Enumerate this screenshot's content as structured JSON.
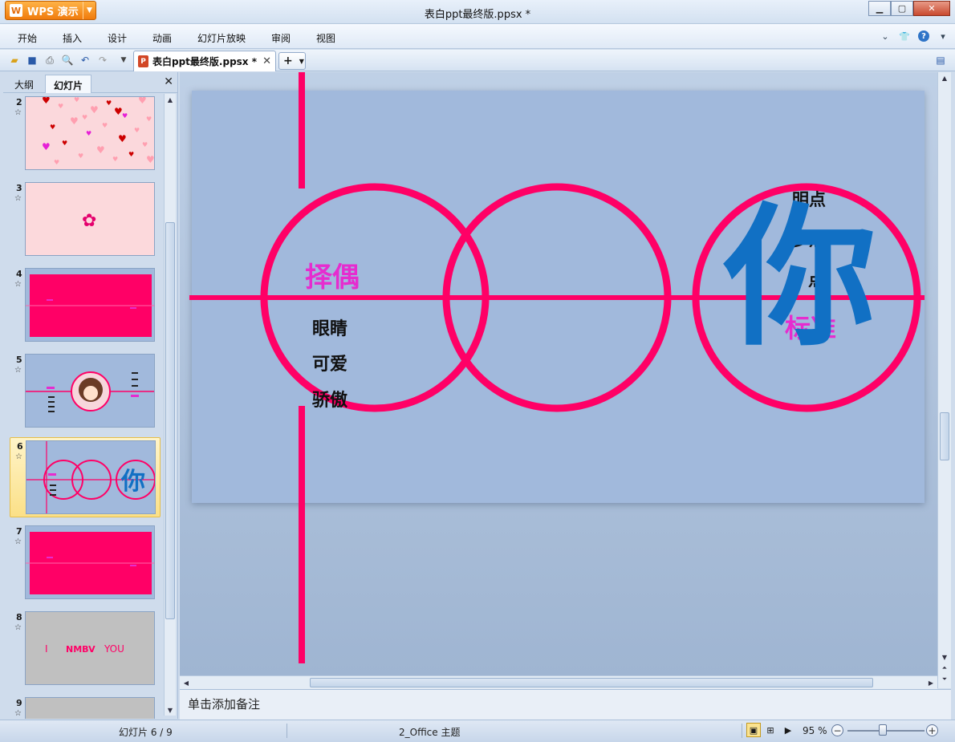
{
  "app": {
    "name": "WPS 演示",
    "doc_title": "表白ppt最终版.ppsx *"
  },
  "menu": [
    "开始",
    "插入",
    "设计",
    "动画",
    "幻灯片放映",
    "审阅",
    "视图"
  ],
  "tab": {
    "label": "表白ppt最终版.ppsx *"
  },
  "left_panel": {
    "tabs": [
      "大纲",
      "幻灯片"
    ],
    "active_tab": "幻灯片",
    "slides": [
      {
        "num": "2",
        "kind": "hearts",
        "bg": "#fbd8dc"
      },
      {
        "num": "3",
        "kind": "flower",
        "bg": "#fcd9dc"
      },
      {
        "num": "4",
        "kind": "pink-lines",
        "bg": "#ff0066"
      },
      {
        "num": "5",
        "kind": "avatar",
        "bg": "#a1b9dc"
      },
      {
        "num": "6",
        "kind": "circles",
        "bg": "#a1b9dc",
        "selected": true
      },
      {
        "num": "7",
        "kind": "pink-lines",
        "bg": "#ff0066"
      },
      {
        "num": "8",
        "kind": "text",
        "bg": "#c0c0c0",
        "text_a": "I",
        "text_b": "NMBV",
        "text_c": "YOU"
      },
      {
        "num": "9",
        "kind": "blank",
        "bg": "#c0c0c0"
      }
    ]
  },
  "slide": {
    "title_left": "择偶",
    "items_left": [
      "眼睛",
      "可爱",
      "骄傲"
    ],
    "items_right": [
      "明点",
      "多点",
      "点"
    ],
    "label_right": "标准",
    "big_char": "你",
    "colors": {
      "line": "#ff0066",
      "magenta": "#e62ccf",
      "blue": "#1170c4",
      "bg": "#a1b9dc"
    }
  },
  "notes_placeholder": "单击添加备注",
  "status": {
    "slide_counter": "幻灯片 6 / 9",
    "theme": "2_Office 主题",
    "zoom": "95 %"
  }
}
